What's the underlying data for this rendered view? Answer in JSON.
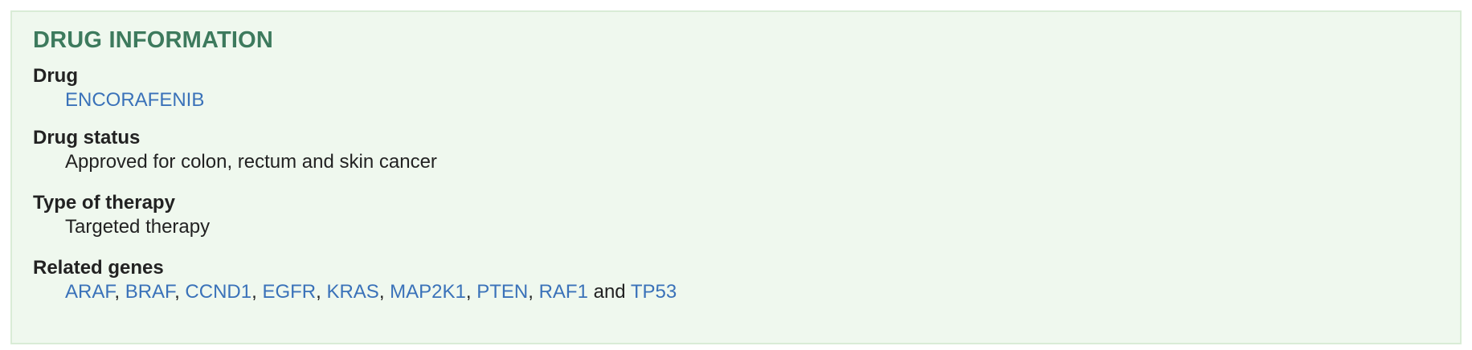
{
  "panel": {
    "title": "DRUG INFORMATION"
  },
  "drug": {
    "label": "Drug",
    "value": "ENCORAFENIB"
  },
  "status": {
    "label": "Drug status",
    "value": "Approved for colon, rectum and skin cancer"
  },
  "therapy": {
    "label": "Type of therapy",
    "value": "Targeted therapy"
  },
  "genes": {
    "label": "Related genes",
    "items": [
      "ARAF",
      "BRAF",
      "CCND1",
      "EGFR",
      "KRAS",
      "MAP2K1",
      "PTEN",
      "RAF1",
      "TP53"
    ],
    "separator": ",",
    "conjunction": "and"
  },
  "colors": {
    "panel_background": "#eff8ee",
    "panel_border": "#d9ecd6",
    "title": "#3d7a5d",
    "link": "#3a72b9",
    "text": "#222222"
  }
}
